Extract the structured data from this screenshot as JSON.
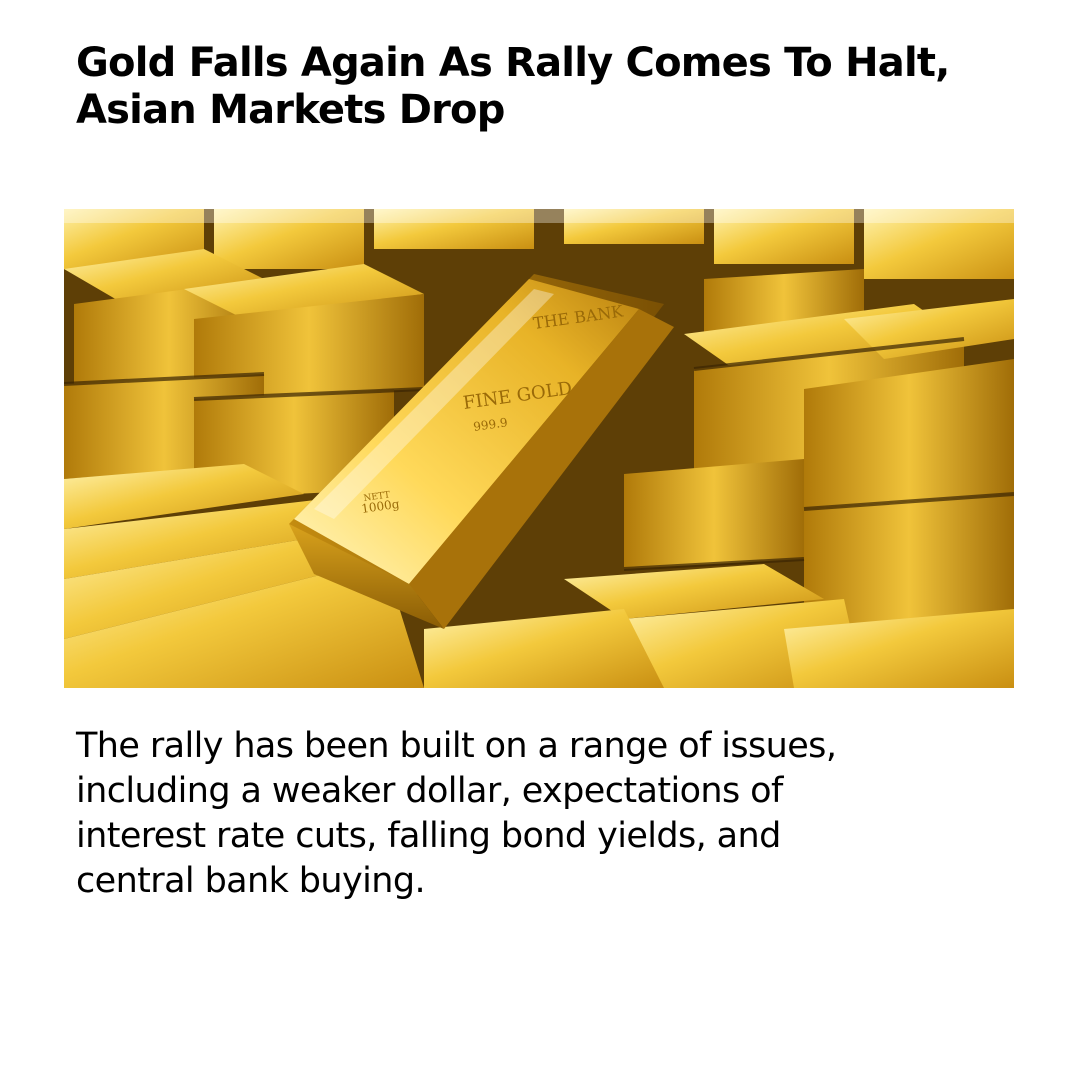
{
  "headline": {
    "line1": "Gold Falls Again As Rally Comes To Halt,",
    "line2": "Asian Markets Drop"
  },
  "image": {
    "subject": "stacked gold bars",
    "bar_stamp": {
      "brand": "THE BANK",
      "grade_label": "FINE GOLD",
      "purity": "999.9",
      "weight_label": "NETT",
      "weight": "1000g"
    },
    "colors": {
      "gold_light": "#ffe27a",
      "gold_mid": "#e6b422",
      "gold_dark": "#8a5c05"
    }
  },
  "body": {
    "line1": "The rally has been built on a range of issues,",
    "line2": "including a weaker dollar, expectations of",
    "line3": "interest rate cuts, falling bond yields, and",
    "line4": "central bank buying."
  }
}
